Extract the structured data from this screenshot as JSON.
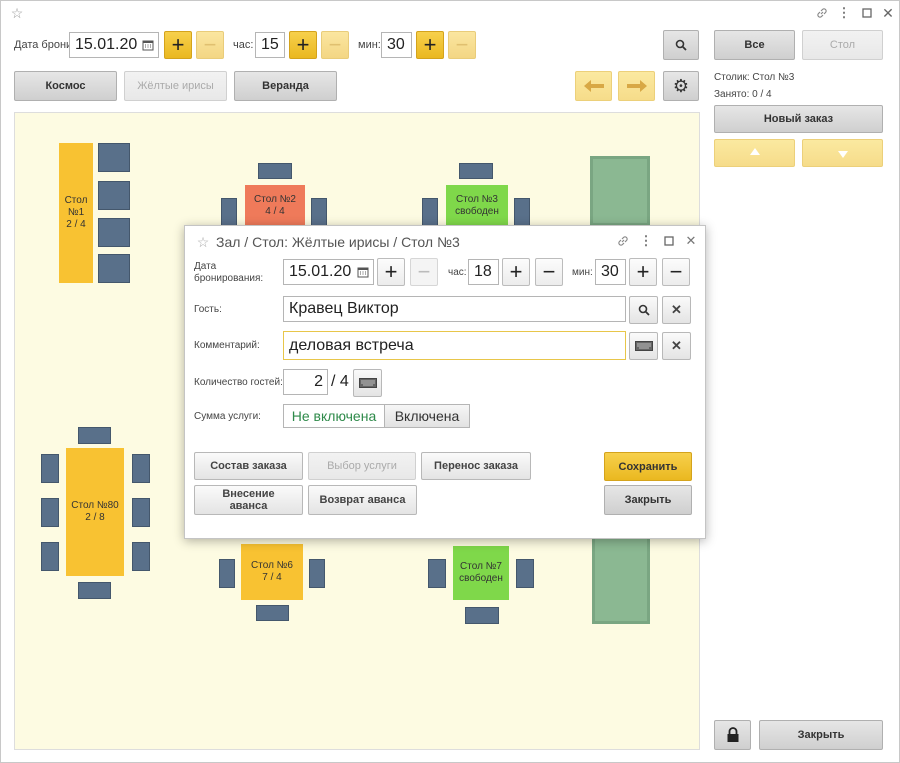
{
  "window": {
    "title_star": "☆"
  },
  "toolbar": {
    "date_label": "Дата брони:",
    "date_value": "15.01.20",
    "hour_label": "час:",
    "hour_value": "15",
    "min_label": "мин:",
    "min_value": "30"
  },
  "halls": [
    {
      "label": "Космос",
      "active": false
    },
    {
      "label": "Жёлтые ирисы",
      "active": true
    },
    {
      "label": "Веранда",
      "active": false
    }
  ],
  "right_panel": {
    "btn_all": "Все",
    "btn_table": "Стол",
    "table_info": "Столик: Стол №3",
    "occupied_info": "Занято: 0 / 4",
    "new_order": "Новый заказ",
    "close": "Закрыть"
  },
  "tables": [
    {
      "id": "t1",
      "line1": "Стол",
      "line2": "№1",
      "line3": "2 / 4",
      "color": "#f8c232"
    },
    {
      "id": "t2",
      "line1": "Стол №2",
      "line2": "4 / 4",
      "color": "#ef7a5a"
    },
    {
      "id": "t3",
      "line1": "Стол №3",
      "line2": "свободен",
      "color": "#7fd84a"
    },
    {
      "id": "t80",
      "line1": "Стол №80",
      "line2": "2 / 8",
      "color": "#f8c232"
    },
    {
      "id": "t6",
      "line1": "Стол №6",
      "line2": "7 / 4",
      "color": "#f8c232"
    },
    {
      "id": "t7",
      "line1": "Стол №7",
      "line2": "свободен",
      "color": "#7fd84a"
    }
  ],
  "dialog": {
    "title": "Зал / Стол: Жёлтые ирисы / Стол №3",
    "date_label": "Дата бронирования:",
    "date_value": "15.01.20",
    "hour_label": "час:",
    "hour_value": "18",
    "min_label": "мин:",
    "min_value": "30",
    "guest_label": "Гость:",
    "guest_value": "Кравец Виктор",
    "comment_label": "Комментарий:",
    "comment_value": "деловая встреча",
    "guests_count_label": "Количество гостей:",
    "guests_count_value": "2",
    "guests_count_max": "/ 4",
    "service_label": "Сумма услуги:",
    "service_off": "Не включена",
    "service_on": "Включена",
    "btn_order": "Состав заказа",
    "btn_service": "Выбор услуги",
    "btn_transfer": "Перенос заказа",
    "btn_advance": "Внесение аванса",
    "btn_refund": "Возврат аванса",
    "btn_save": "Сохранить",
    "btn_close": "Закрыть"
  }
}
